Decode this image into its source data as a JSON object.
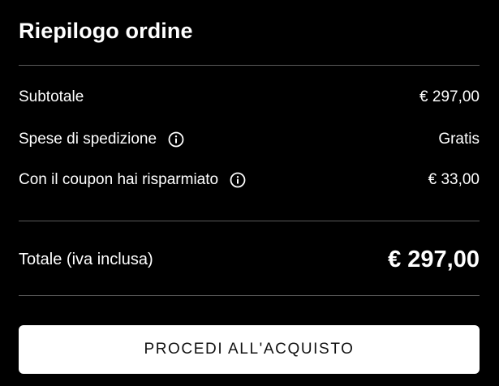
{
  "summary": {
    "title": "Riepilogo ordine",
    "rows": [
      {
        "label": "Subtotale",
        "value": "€ 297,00",
        "has_info": false
      },
      {
        "label": "Spese di spedizione",
        "value": "Gratis",
        "has_info": true,
        "icon": "info-icon"
      },
      {
        "label": "Con il coupon hai risparmiato",
        "value": "€ 33,00",
        "has_info": true,
        "icon": "info-icon"
      }
    ],
    "total": {
      "label": "Totale (iva inclusa)",
      "value": "€ 297,00"
    },
    "checkout_button": {
      "label": "PROCEDI ALL'ACQUISTO"
    }
  },
  "colors": {
    "background": "#000000",
    "text": "#ffffff",
    "divider": "#5a5a5a",
    "button_bg": "#ffffff",
    "button_text": "#111111"
  }
}
